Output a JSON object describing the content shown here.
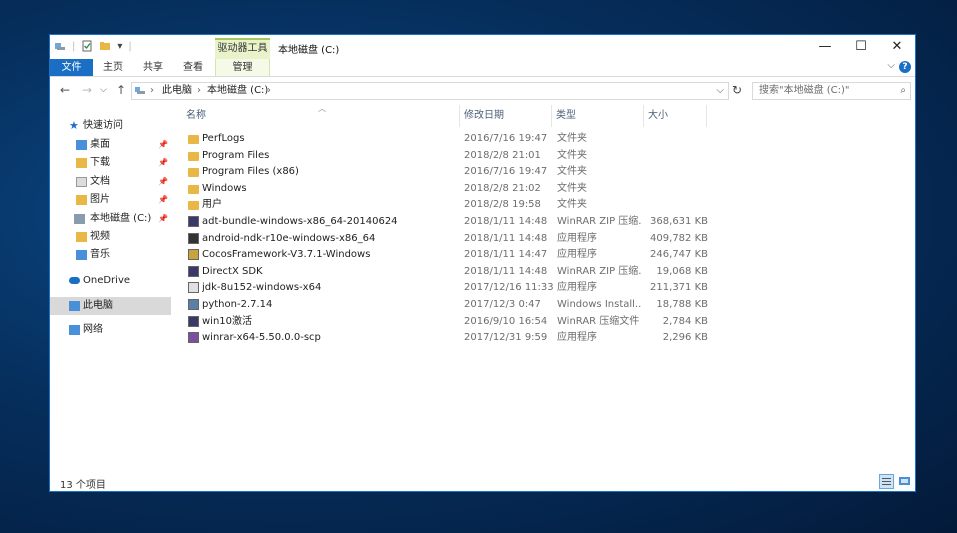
{
  "window": {
    "title": "本地磁盘 (C:)",
    "context_tab_group": "驱动器工具",
    "controls": {
      "minimize": "—",
      "maximize": "☐",
      "close": "✕"
    }
  },
  "ribbon": {
    "tabs": [
      "文件",
      "主页",
      "共享",
      "查看",
      "管理"
    ],
    "help": "?"
  },
  "address": {
    "segments": [
      "此电脑",
      "本地磁盘 (C:)"
    ],
    "search_placeholder": "搜索\"本地磁盘 (C:)\""
  },
  "nav": {
    "quick_access": "快速访问",
    "quick_items": [
      "桌面",
      "下载",
      "文档",
      "图片",
      "本地磁盘 (C:)",
      "视频",
      "音乐"
    ],
    "onedrive": "OneDrive",
    "this_pc": "此电脑",
    "network": "网络"
  },
  "columns": {
    "name": "名称",
    "date": "修改日期",
    "type": "类型",
    "size": "大小"
  },
  "files": [
    {
      "name": "PerfLogs",
      "date": "2016/7/16 19:47",
      "type": "文件夹",
      "size": "",
      "icon": "folder-icon"
    },
    {
      "name": "Program Files",
      "date": "2018/2/8 21:01",
      "type": "文件夹",
      "size": "",
      "icon": "folder-icon"
    },
    {
      "name": "Program Files (x86)",
      "date": "2016/7/16 19:47",
      "type": "文件夹",
      "size": "",
      "icon": "folder-icon"
    },
    {
      "name": "Windows",
      "date": "2018/2/8 21:02",
      "type": "文件夹",
      "size": "",
      "icon": "folder-icon"
    },
    {
      "name": "用户",
      "date": "2018/2/8 19:58",
      "type": "文件夹",
      "size": "",
      "icon": "folder-icon"
    },
    {
      "name": "adt-bundle-windows-x86_64-20140624",
      "date": "2018/1/11 14:48",
      "type": "WinRAR ZIP 压缩...",
      "size": "368,631 KB",
      "icon": "archive-icon"
    },
    {
      "name": "android-ndk-r10e-windows-x86_64",
      "date": "2018/1/11 14:48",
      "type": "应用程序",
      "size": "409,782 KB",
      "icon": "app-icon"
    },
    {
      "name": "CocosFramework-V3.7.1-Windows",
      "date": "2018/1/11 14:47",
      "type": "应用程序",
      "size": "246,747 KB",
      "icon": "setup-icon"
    },
    {
      "name": "DirectX SDK",
      "date": "2018/1/11 14:48",
      "type": "WinRAR ZIP 压缩...",
      "size": "19,068 KB",
      "icon": "archive-icon"
    },
    {
      "name": "jdk-8u152-windows-x64",
      "date": "2017/12/16 11:33",
      "type": "应用程序",
      "size": "211,371 KB",
      "icon": "java-icon"
    },
    {
      "name": "python-2.7.14",
      "date": "2017/12/3 0:47",
      "type": "Windows Install...",
      "size": "18,788 KB",
      "icon": "installer-icon"
    },
    {
      "name": "win10激活",
      "date": "2016/9/10 16:54",
      "type": "WinRAR 压缩文件",
      "size": "2,784 KB",
      "icon": "archive-icon"
    },
    {
      "name": "winrar-x64-5.50.0.0-scp",
      "date": "2017/12/31 9:59",
      "type": "应用程序",
      "size": "2,296 KB",
      "icon": "winrar-icon"
    }
  ],
  "status": {
    "item_count": "13 个项目"
  },
  "colors": {
    "accent": "#1a6fc4",
    "folder": "#e8b746",
    "context_tab": "#e9f3c9"
  }
}
